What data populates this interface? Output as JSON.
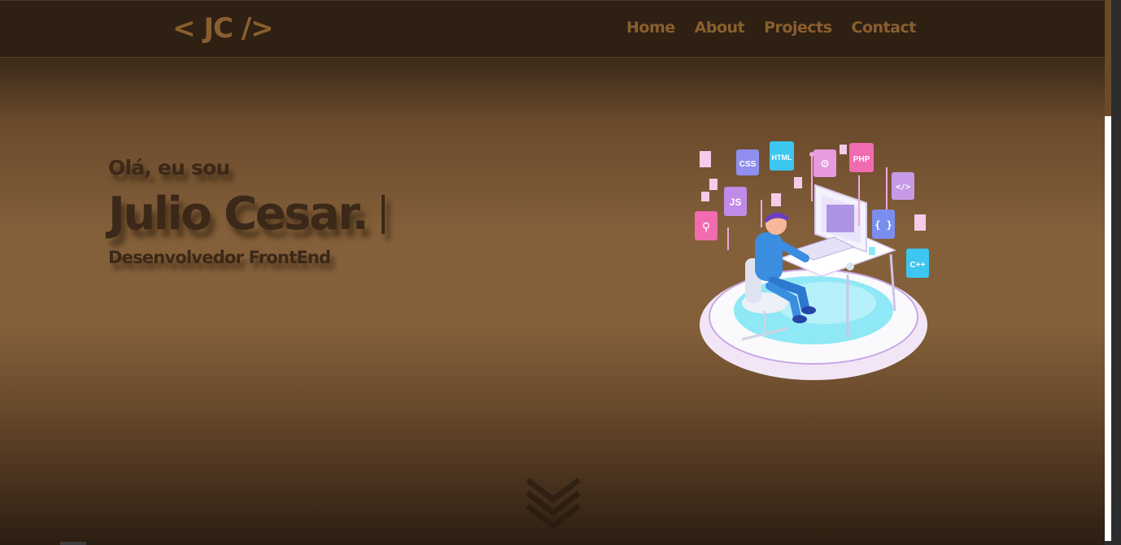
{
  "nav": {
    "logo": "< JC />",
    "links": [
      "Home",
      "About",
      "Projects",
      "Contact"
    ]
  },
  "hero": {
    "greeting": "Olá, eu sou",
    "name": "Julio Cesar.",
    "role": "Desenvolvedor FrontEnd"
  },
  "illustration": {
    "badges": [
      "CSS",
      "HTML",
      "PHP",
      "JS",
      "{ }",
      "C++"
    ]
  },
  "icons": {
    "scroll": "double-chevron-down-icon"
  },
  "colors": {
    "accent": "#8a5f2e",
    "text_dark": "#3b2818",
    "nav_bg": "#2e2013"
  }
}
